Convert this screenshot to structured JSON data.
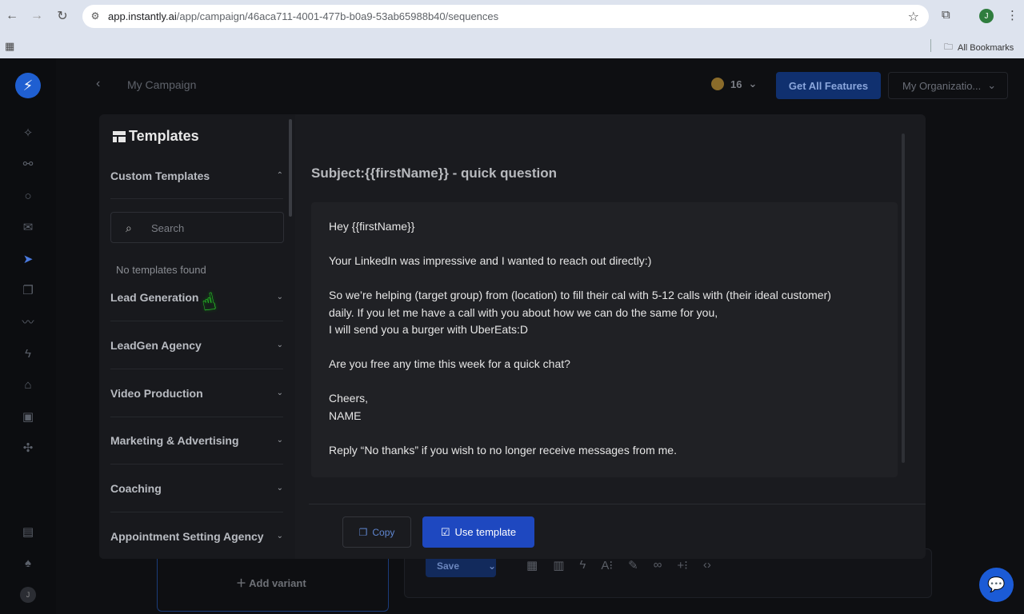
{
  "browser": {
    "url_host": "app.instantly.ai",
    "url_path": "/app/campaign/46aca711-4001-477b-b0a9-53ab65988b40/sequences",
    "profile_initial": "J",
    "bookmarks_label": "All Bookmarks"
  },
  "topbar": {
    "campaign_title": "My Campaign",
    "credits": "16",
    "get_features": "Get All Features",
    "organization": "My Organizatio..."
  },
  "background": {
    "add_variant": "Add variant",
    "save": "Save",
    "user_initial": "J"
  },
  "templates": {
    "title": "Templates",
    "search_placeholder": "Search",
    "empty_text": "No templates found",
    "categories": [
      {
        "label": "Custom Templates",
        "expanded": true
      },
      {
        "label": "Lead Generation",
        "expanded": false
      },
      {
        "label": "LeadGen Agency",
        "expanded": false
      },
      {
        "label": "Video Production",
        "expanded": false
      },
      {
        "label": "Marketing & Advertising",
        "expanded": false
      },
      {
        "label": "Coaching",
        "expanded": false
      },
      {
        "label": "Appointment Setting Agency",
        "expanded": false
      }
    ]
  },
  "preview": {
    "subject": "Subject:{{firstName}} - quick question",
    "lines": [
      "Hey {{firstName}}",
      "Your LinkedIn was impressive and I wanted to reach out directly:)",
      "So we’re helping (target group) from (location) to fill their cal with 5-12 calls with (their ideal customer)",
      "daily. If you let me have a call with you about how we can do the same for you,",
      "I will send you a burger with UberEats:D",
      "Are you free any time this week for a quick chat?",
      "Cheers,",
      "NAME",
      "Reply “No thanks” if you wish to no longer receive messages from me."
    ],
    "copy": "Copy",
    "use_template": "Use template"
  }
}
